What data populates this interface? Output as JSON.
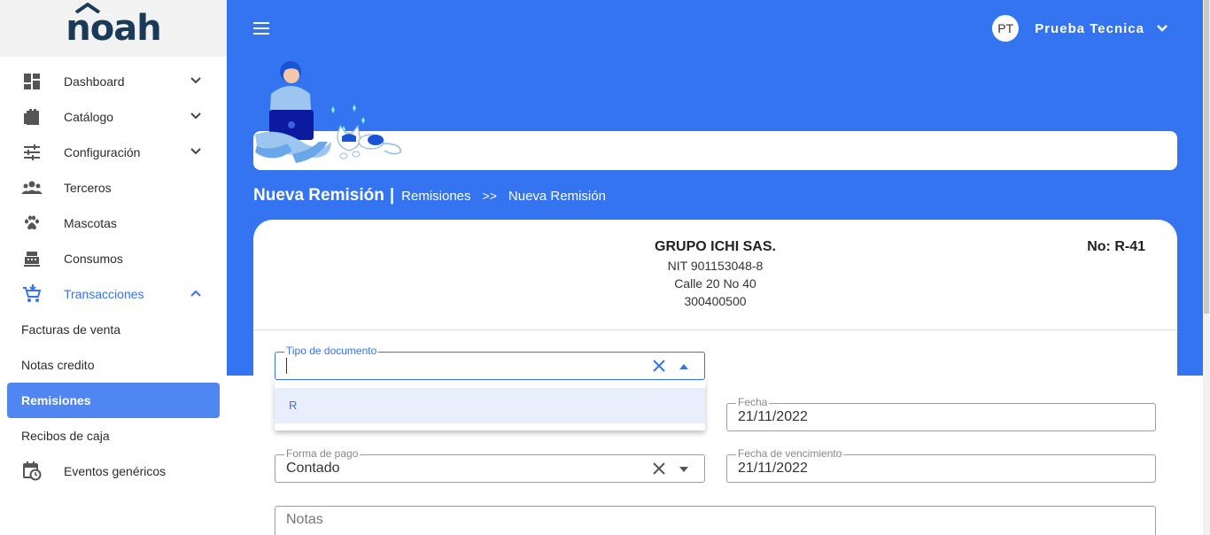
{
  "app": {
    "logo_text": "noah"
  },
  "sidebar": {
    "items": [
      {
        "label": "Dashboard",
        "icon": "dashboard-icon"
      },
      {
        "label": "Catálogo",
        "icon": "catalog-icon"
      },
      {
        "label": "Configuración",
        "icon": "sliders-icon"
      },
      {
        "label": "Terceros",
        "icon": "people-icon"
      },
      {
        "label": "Mascotas",
        "icon": "paw-icon"
      },
      {
        "label": "Consumos",
        "icon": "cash-register-icon"
      },
      {
        "label": "Transacciones",
        "icon": "cart-icon"
      }
    ],
    "subitems": [
      {
        "label": "Facturas de venta"
      },
      {
        "label": "Notas credito"
      },
      {
        "label": "Remisiones"
      },
      {
        "label": "Recibos de caja"
      }
    ],
    "events": {
      "label": "Eventos genéricos",
      "icon": "calendar-clock-icon"
    }
  },
  "header": {
    "user_initials": "PT",
    "user_name": "Prueba Tecnica"
  },
  "breadcrumb": {
    "title": "Nueva Remisión",
    "separator": "|",
    "parent": "Remisiones",
    "arrow": ">>",
    "current": "Nueva Remisión"
  },
  "company": {
    "name": "GRUPO ICHI SAS.",
    "nit": "NIT 901153048-8",
    "address": "Calle 20 No 40",
    "phone": "300400500"
  },
  "document": {
    "number": "No: R-41"
  },
  "form": {
    "tipo_documento": {
      "label": "Tipo de documento",
      "value": ""
    },
    "tipo_options": [
      "R"
    ],
    "fecha": {
      "label": "Fecha",
      "value": "21/11/2022"
    },
    "forma_pago": {
      "label": "Forma de pago",
      "value": "Contado"
    },
    "fecha_vencimiento": {
      "label": "Fecha de vencimiento",
      "value": "21/11/2022"
    },
    "notas": {
      "placeholder": "Notas"
    }
  },
  "colors": {
    "primary": "#3474f1",
    "selected_nav": "#4f86f2",
    "logo": "#1b3a57"
  }
}
